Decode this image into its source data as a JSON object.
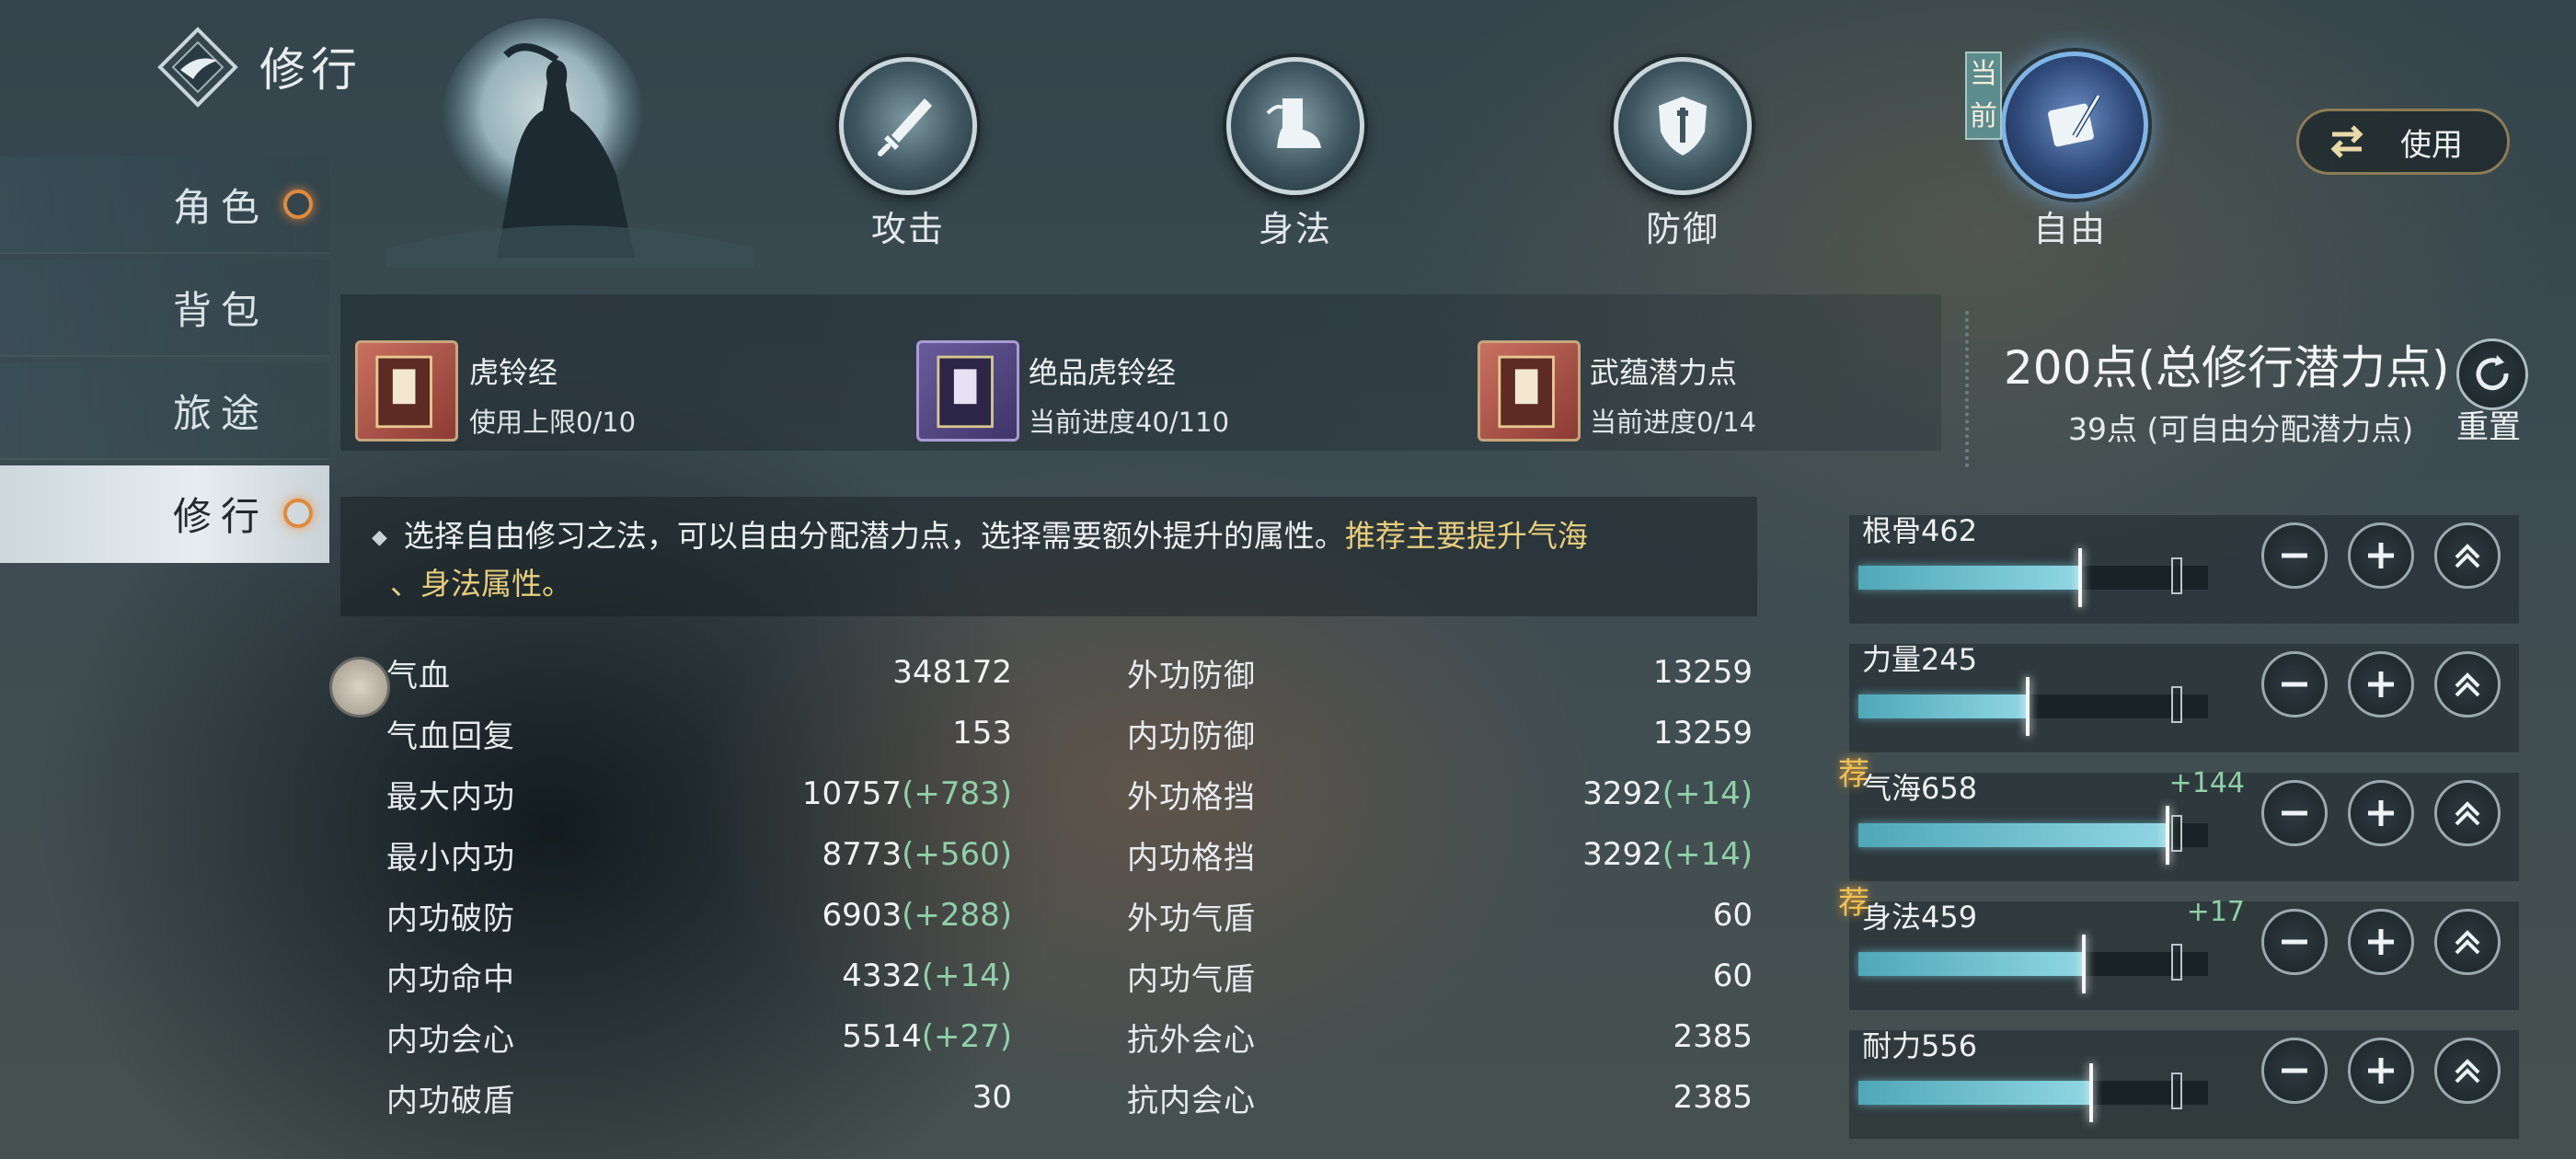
{
  "header": {
    "title": "修行"
  },
  "sidebar": {
    "items": [
      {
        "label": "角色",
        "has_dot": true
      },
      {
        "label": "背包",
        "has_dot": false
      },
      {
        "label": "旅途",
        "has_dot": false
      },
      {
        "label": "修行",
        "has_dot": true,
        "active": true
      }
    ]
  },
  "tabs": [
    {
      "label": "攻击",
      "icon": "sword-icon"
    },
    {
      "label": "身法",
      "icon": "boot-icon"
    },
    {
      "label": "防御",
      "icon": "shield-icon"
    },
    {
      "label": "自由",
      "icon": "scroll-quill-icon",
      "current": true
    }
  ],
  "current_tag": "当前",
  "use_button": {
    "label": "使用"
  },
  "items": [
    {
      "name": "虎铃经",
      "sub": "使用上限0/10",
      "color": "red"
    },
    {
      "name": "绝品虎铃经",
      "sub": "当前进度40/110",
      "color": "purple"
    },
    {
      "name": "武蕴潜力点",
      "sub": "当前进度0/14",
      "color": "red"
    }
  ],
  "points": {
    "total": "200点(总修行潜力点)",
    "free": "39点 (可自由分配潜力点)",
    "reset_label": "重置"
  },
  "description": {
    "text": "选择自由修习之法，可以自由分配潜力点，选择需要额外提升的属性。",
    "highlight1": "推荐主要提升气海",
    "highlight2": "、身法属性。"
  },
  "stats_left": [
    {
      "name": "气血",
      "value": "348172",
      "bonus": ""
    },
    {
      "name": "气血回复",
      "value": "153",
      "bonus": ""
    },
    {
      "name": "最大内功",
      "value": "10757",
      "bonus": "(+783)"
    },
    {
      "name": "最小内功",
      "value": "8773",
      "bonus": "(+560)"
    },
    {
      "name": "内功破防",
      "value": "6903",
      "bonus": "(+288)"
    },
    {
      "name": "内功命中",
      "value": "4332",
      "bonus": "(+14)"
    },
    {
      "name": "内功会心",
      "value": "5514",
      "bonus": "(+27)"
    },
    {
      "name": "内功破盾",
      "value": "30",
      "bonus": ""
    }
  ],
  "stats_right": [
    {
      "name": "外功防御",
      "value": "13259",
      "bonus": ""
    },
    {
      "name": "内功防御",
      "value": "13259",
      "bonus": ""
    },
    {
      "name": "外功格挡",
      "value": "3292",
      "bonus": "(+14)"
    },
    {
      "name": "内功格挡",
      "value": "3292",
      "bonus": "(+14)"
    },
    {
      "name": "外功气盾",
      "value": "60",
      "bonus": ""
    },
    {
      "name": "内功气盾",
      "value": "60",
      "bonus": ""
    },
    {
      "name": "抗外会心",
      "value": "2385",
      "bonus": ""
    },
    {
      "name": "抗内会心",
      "value": "2385",
      "bonus": ""
    }
  ],
  "attributes": [
    {
      "name": "根骨462",
      "plus": "",
      "recommended": false,
      "fill": 0.63
    },
    {
      "name": "力量245",
      "plus": "",
      "recommended": false,
      "fill": 0.48
    },
    {
      "name": "气海658",
      "plus": "+144",
      "recommended": true,
      "fill": 0.88
    },
    {
      "name": "身法459",
      "plus": "+17",
      "recommended": true,
      "fill": 0.64
    },
    {
      "name": "耐力556",
      "plus": "",
      "recommended": false,
      "fill": 0.66
    }
  ],
  "rec_tag": "荐",
  "colors": {
    "bonus": "#8fd0a8",
    "highlight": "#e7cd7c",
    "accent_dot": "#e08a3c"
  }
}
